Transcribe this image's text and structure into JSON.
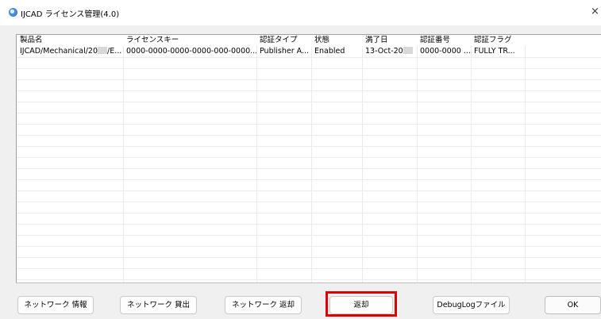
{
  "window": {
    "title": "IJCAD ライセンス管理(4.0)",
    "close_glyph": "×",
    "icon": "app-icon"
  },
  "list": {
    "columns": [
      "製品名",
      "ライセンスキー",
      "認証タイプ",
      "状態",
      "満了日",
      "認証番号",
      "認証フラグ"
    ],
    "rows": [
      {
        "product_prefix": "IJCAD/Mechanical/20",
        "product_suffix": "/E...",
        "license_key": "0000-0000-0000-0000-000-0000...",
        "auth_type": "Publisher A...",
        "status": "Enabled",
        "expiry_prefix": "13-Oct-20",
        "auth_number": "0000-0000 ...",
        "auth_flag": "FULLY TR..."
      }
    ]
  },
  "buttons": {
    "network_info": "ネットワーク 情報",
    "network_lend": "ネットワーク 貸出",
    "network_return": "ネットワーク 返却",
    "return": "返却",
    "debug_log": "DebugLogファイル",
    "ok": "OK"
  },
  "highlight_color": "#e00000"
}
